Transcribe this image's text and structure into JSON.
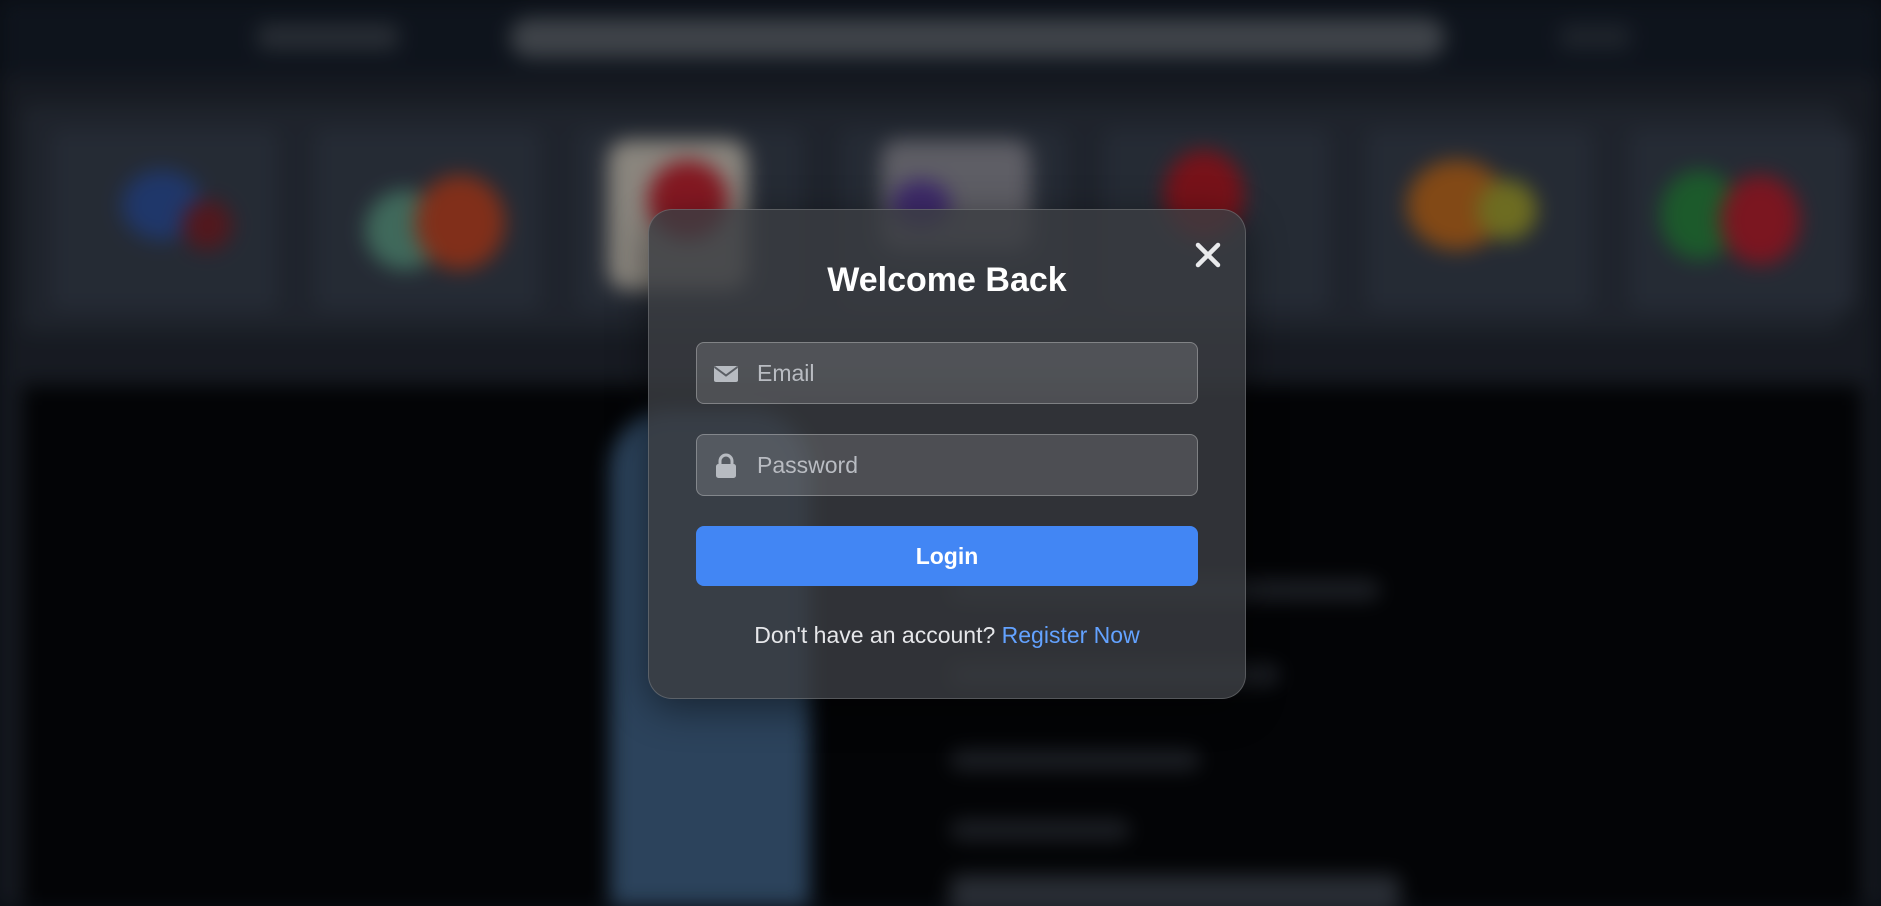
{
  "login_modal": {
    "title": "Welcome Back",
    "close_icon": "close-icon",
    "email": {
      "icon": "envelope-icon",
      "placeholder": "Email",
      "value": ""
    },
    "password": {
      "icon": "lock-icon",
      "placeholder": "Password",
      "value": ""
    },
    "login_button_label": "Login",
    "register_prompt": "Don't have an account?",
    "register_link_label": "Register Now"
  },
  "colors": {
    "accent": "#4286f4",
    "link": "#63a2ff",
    "modal_background": "#3a3d42",
    "title_text": "#ffffff"
  }
}
